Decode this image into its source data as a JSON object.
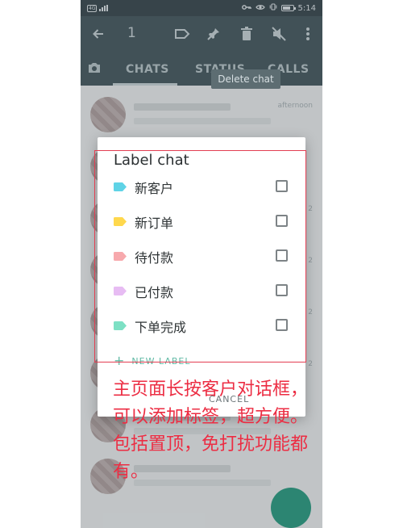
{
  "status_bar": {
    "sim_label": "4G",
    "time": "5:14",
    "icons": [
      "sim-icon",
      "signal-icon",
      "key-icon",
      "eye-icon",
      "vibrate-icon",
      "battery-icon"
    ],
    "battery_level": 0.75
  },
  "app_bar": {
    "selected_count": "1",
    "icons": [
      "back-arrow-icon",
      "label-icon",
      "pin-icon",
      "delete-icon",
      "mute-icon",
      "more-vert-icon"
    ]
  },
  "tabs": {
    "items": [
      {
        "label": "CHATS"
      },
      {
        "label": "STATUS"
      },
      {
        "label": "CALLS"
      }
    ],
    "camera_icon": "camera-icon"
  },
  "tooltip": {
    "text": "Delete chat"
  },
  "dialog": {
    "title": "Label chat",
    "labels": [
      {
        "text": "新客户",
        "color": "#5fd3e6",
        "checked": false
      },
      {
        "text": "新订单",
        "color": "#ffd84d",
        "checked": false
      },
      {
        "text": "待付款",
        "color": "#f7a9ad",
        "checked": false
      },
      {
        "text": "已付款",
        "color": "#e7bcf3",
        "checked": false
      },
      {
        "text": "下单完成",
        "color": "#7de0c4",
        "checked": false
      }
    ],
    "new_label": "NEW LABEL",
    "cancel": "CANCEL"
  },
  "chat_rows": [
    {
      "meta": "afternoon"
    },
    {
      "meta": ""
    },
    {
      "meta": "2"
    },
    {
      "meta": "2"
    },
    {
      "meta": "2"
    },
    {
      "meta": "2"
    },
    {
      "meta": ""
    },
    {
      "meta": ""
    }
  ],
  "caption": {
    "lines": [
      "主页面长按客户对话框，可以添加标签，超方便。",
      "包括置顶，免打扰功能都有。"
    ]
  },
  "colors": {
    "app_bar": "#485a61",
    "accent": "#2e9d83",
    "annotation_red": "#e33e52"
  }
}
